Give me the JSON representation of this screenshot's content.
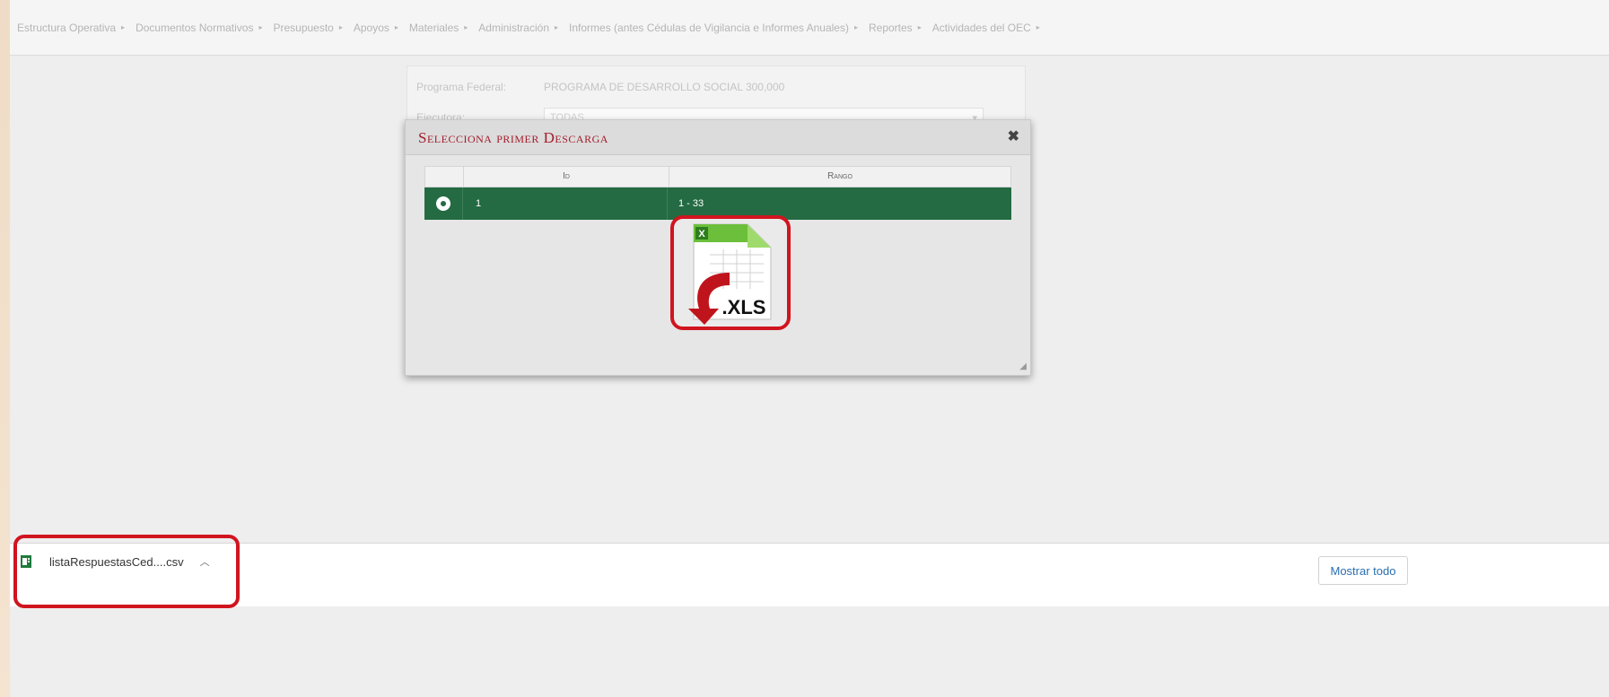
{
  "menubar": {
    "items": [
      {
        "label": "Estructura Operativa"
      },
      {
        "label": "Documentos Normativos"
      },
      {
        "label": "Presupuesto"
      },
      {
        "label": "Apoyos"
      },
      {
        "label": "Materiales"
      },
      {
        "label": "Administración"
      },
      {
        "label": "Informes (antes Cédulas de Vigilancia e Informes Anuales)"
      },
      {
        "label": "Reportes"
      },
      {
        "label": "Actividades del OEC"
      }
    ]
  },
  "form": {
    "programa_label": "Programa Federal:",
    "programa_value": "PROGRAMA DE DESARROLLO SOCIAL 300,000",
    "ejecutora_label": "Ejecutora:",
    "ejecutora_value": "TODAS"
  },
  "modal": {
    "title": "Selecciona primer Descarga",
    "columns": [
      "Id",
      "Rango"
    ],
    "rows": [
      {
        "id": "1",
        "rango": "1 - 33",
        "selected": true
      }
    ],
    "file_badge": ".XLS"
  },
  "download_bar": {
    "file_name": "listaRespuestasCed....csv",
    "show_all_label": "Mostrar todo"
  },
  "colors": {
    "accent_green": "#246b43",
    "title_red": "#a31c2a",
    "highlight_red": "#d0151f",
    "link_blue": "#2a6fb0"
  },
  "icons": [
    "close-icon",
    "xls-download-icon",
    "csv-file-icon",
    "chevron-up-icon",
    "dropdown-caret-icon",
    "radio-selected-icon",
    "resize-grip-icon"
  ]
}
